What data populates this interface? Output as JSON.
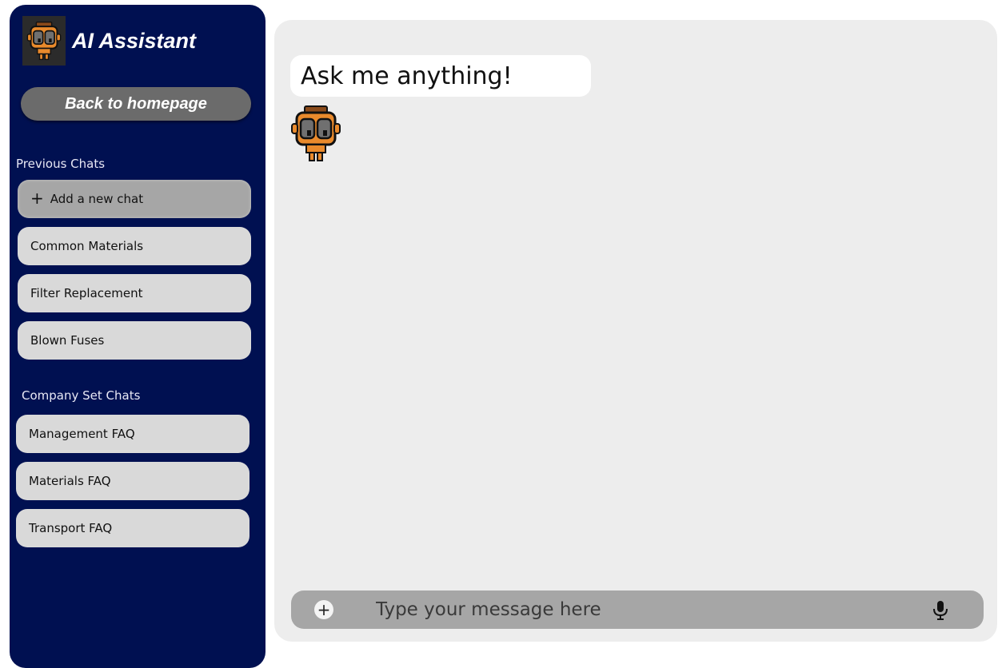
{
  "brand": {
    "title": "AI Assistant",
    "logo_icon": "robot-mascot-icon"
  },
  "sidebar": {
    "home_label": "Back to homepage",
    "previous_label": "Previous Chats",
    "new_chat_label": "Add a new chat",
    "previous_chats": [
      "Common Materials",
      "Filter Replacement",
      "Blown Fuses"
    ],
    "company_label": "Company Set Chats",
    "company_chats": [
      "Management FAQ",
      "Materials FAQ",
      "Transport FAQ"
    ]
  },
  "chat": {
    "greeting": "Ask me anything!",
    "avatar_icon": "robot-mascot-icon"
  },
  "composer": {
    "placeholder": "Type your message here",
    "add_icon": "plus-icon",
    "mic_icon": "microphone-icon"
  },
  "colors": {
    "sidebar_bg": "#001051",
    "panel_bg": "#ededed",
    "chat_item_bg": "#d9d9d9",
    "composer_bg": "#a6a6a6",
    "mascot_orange": "#e98a2c"
  }
}
